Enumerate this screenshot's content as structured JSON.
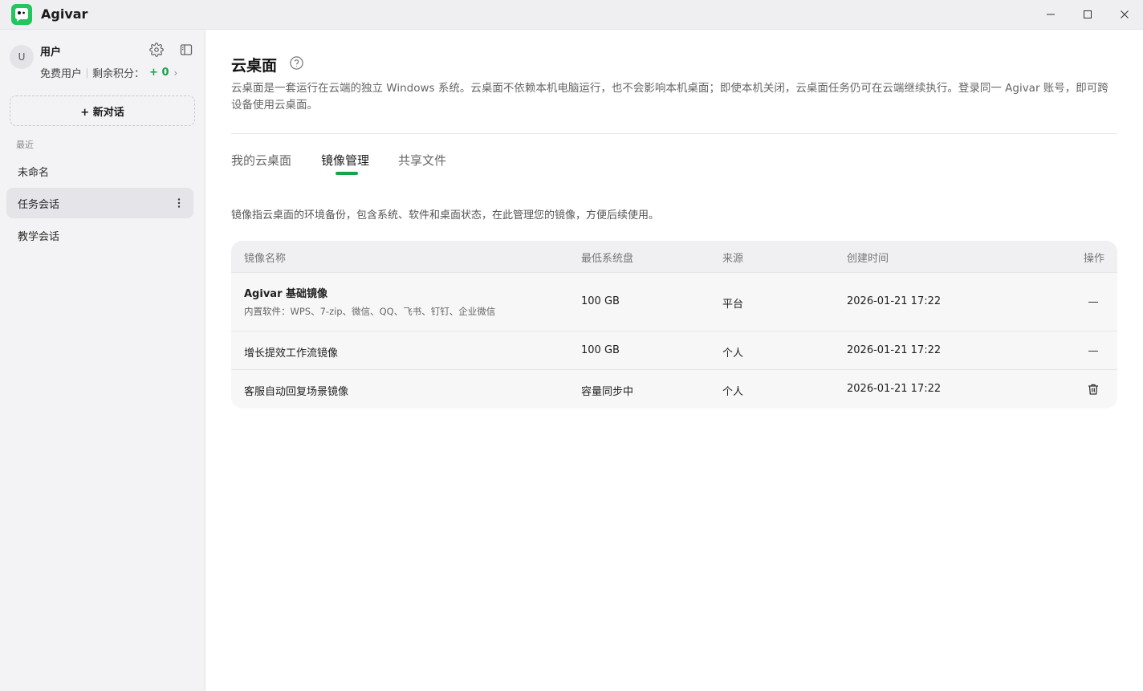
{
  "app": {
    "title": "Agivar",
    "logo_icon": "agivar-logo",
    "window_controls": [
      "minimize-icon",
      "maximize-icon",
      "close-icon"
    ]
  },
  "sidebar": {
    "user": {
      "avatar_letter": "U",
      "name": "用户",
      "plan": "免费用户",
      "points_label": "剩余积分：",
      "points_value": "+ 0",
      "points_chevron": "›"
    },
    "settings_icon": "gear-icon",
    "toggle_icon": "sidebar-panel-icon",
    "new_chat_label": "+ 新对话",
    "recent_label": "最近",
    "conversations": [
      {
        "label": "未命名",
        "active": false
      },
      {
        "label": "任务会话",
        "active": true
      },
      {
        "label": "教学会话",
        "active": false
      }
    ]
  },
  "main": {
    "title": "云桌面",
    "help_icon": "help-circle-icon",
    "description": "云桌面是一套运行在云端的独立 Windows 系统。云桌面不依赖本机电脑运行，也不会影响本机桌面；即使本机关闭，云桌面任务仍可在云端继续执行。登录同一 Agivar 账号，即可跨设备使用云桌面。",
    "tabs": [
      {
        "label": "我的云桌面",
        "active": false
      },
      {
        "label": "镜像管理",
        "active": true
      },
      {
        "label": "共享文件",
        "active": false
      }
    ],
    "tab_hint": "镜像指云桌面的环境备份，包含系统、软件和桌面状态，在此管理您的镜像，方便后续使用。",
    "accent_color": "#16a34a",
    "table": {
      "headers": {
        "name": "镜像名称",
        "min_disk": "最低系统盘",
        "source": "来源",
        "created": "创建时间",
        "actions": "操作"
      },
      "rows": [
        {
          "name": "Agivar 基础镜像",
          "subtitle": "内置软件：WPS、7-zip、微信、QQ、飞书、钉钉、企业微信",
          "min_disk": "100 GB",
          "source": "平台",
          "created": "2026-01-21 17:22",
          "action": "dash-icon"
        },
        {
          "name": "增长提效工作流镜像",
          "min_disk": "100 GB",
          "source": "个人",
          "created": "2026-01-21 17:22",
          "action": "dash-icon"
        },
        {
          "name": "客服自动回复场景镜像",
          "min_disk": "容量同步中",
          "source": "个人",
          "created": "2026-01-21 17:22",
          "action": "trash-icon"
        }
      ]
    }
  }
}
